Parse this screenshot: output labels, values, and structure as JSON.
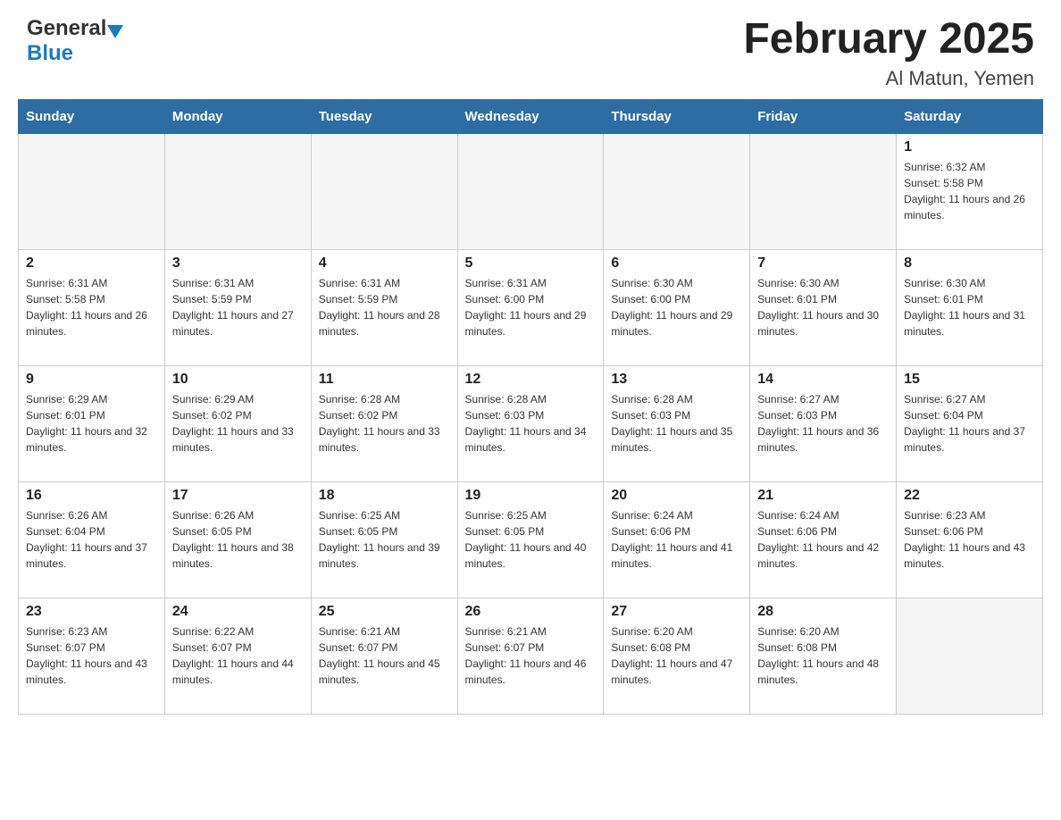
{
  "header": {
    "logo_general": "General",
    "logo_blue": "Blue",
    "title": "February 2025",
    "subtitle": "Al Matun, Yemen"
  },
  "calendar": {
    "days_of_week": [
      "Sunday",
      "Monday",
      "Tuesday",
      "Wednesday",
      "Thursday",
      "Friday",
      "Saturday"
    ],
    "weeks": [
      [
        {
          "day": "",
          "info": ""
        },
        {
          "day": "",
          "info": ""
        },
        {
          "day": "",
          "info": ""
        },
        {
          "day": "",
          "info": ""
        },
        {
          "day": "",
          "info": ""
        },
        {
          "day": "",
          "info": ""
        },
        {
          "day": "1",
          "info": "Sunrise: 6:32 AM\nSunset: 5:58 PM\nDaylight: 11 hours and 26 minutes."
        }
      ],
      [
        {
          "day": "2",
          "info": "Sunrise: 6:31 AM\nSunset: 5:58 PM\nDaylight: 11 hours and 26 minutes."
        },
        {
          "day": "3",
          "info": "Sunrise: 6:31 AM\nSunset: 5:59 PM\nDaylight: 11 hours and 27 minutes."
        },
        {
          "day": "4",
          "info": "Sunrise: 6:31 AM\nSunset: 5:59 PM\nDaylight: 11 hours and 28 minutes."
        },
        {
          "day": "5",
          "info": "Sunrise: 6:31 AM\nSunset: 6:00 PM\nDaylight: 11 hours and 29 minutes."
        },
        {
          "day": "6",
          "info": "Sunrise: 6:30 AM\nSunset: 6:00 PM\nDaylight: 11 hours and 29 minutes."
        },
        {
          "day": "7",
          "info": "Sunrise: 6:30 AM\nSunset: 6:01 PM\nDaylight: 11 hours and 30 minutes."
        },
        {
          "day": "8",
          "info": "Sunrise: 6:30 AM\nSunset: 6:01 PM\nDaylight: 11 hours and 31 minutes."
        }
      ],
      [
        {
          "day": "9",
          "info": "Sunrise: 6:29 AM\nSunset: 6:01 PM\nDaylight: 11 hours and 32 minutes."
        },
        {
          "day": "10",
          "info": "Sunrise: 6:29 AM\nSunset: 6:02 PM\nDaylight: 11 hours and 33 minutes."
        },
        {
          "day": "11",
          "info": "Sunrise: 6:28 AM\nSunset: 6:02 PM\nDaylight: 11 hours and 33 minutes."
        },
        {
          "day": "12",
          "info": "Sunrise: 6:28 AM\nSunset: 6:03 PM\nDaylight: 11 hours and 34 minutes."
        },
        {
          "day": "13",
          "info": "Sunrise: 6:28 AM\nSunset: 6:03 PM\nDaylight: 11 hours and 35 minutes."
        },
        {
          "day": "14",
          "info": "Sunrise: 6:27 AM\nSunset: 6:03 PM\nDaylight: 11 hours and 36 minutes."
        },
        {
          "day": "15",
          "info": "Sunrise: 6:27 AM\nSunset: 6:04 PM\nDaylight: 11 hours and 37 minutes."
        }
      ],
      [
        {
          "day": "16",
          "info": "Sunrise: 6:26 AM\nSunset: 6:04 PM\nDaylight: 11 hours and 37 minutes."
        },
        {
          "day": "17",
          "info": "Sunrise: 6:26 AM\nSunset: 6:05 PM\nDaylight: 11 hours and 38 minutes."
        },
        {
          "day": "18",
          "info": "Sunrise: 6:25 AM\nSunset: 6:05 PM\nDaylight: 11 hours and 39 minutes."
        },
        {
          "day": "19",
          "info": "Sunrise: 6:25 AM\nSunset: 6:05 PM\nDaylight: 11 hours and 40 minutes."
        },
        {
          "day": "20",
          "info": "Sunrise: 6:24 AM\nSunset: 6:06 PM\nDaylight: 11 hours and 41 minutes."
        },
        {
          "day": "21",
          "info": "Sunrise: 6:24 AM\nSunset: 6:06 PM\nDaylight: 11 hours and 42 minutes."
        },
        {
          "day": "22",
          "info": "Sunrise: 6:23 AM\nSunset: 6:06 PM\nDaylight: 11 hours and 43 minutes."
        }
      ],
      [
        {
          "day": "23",
          "info": "Sunrise: 6:23 AM\nSunset: 6:07 PM\nDaylight: 11 hours and 43 minutes."
        },
        {
          "day": "24",
          "info": "Sunrise: 6:22 AM\nSunset: 6:07 PM\nDaylight: 11 hours and 44 minutes."
        },
        {
          "day": "25",
          "info": "Sunrise: 6:21 AM\nSunset: 6:07 PM\nDaylight: 11 hours and 45 minutes."
        },
        {
          "day": "26",
          "info": "Sunrise: 6:21 AM\nSunset: 6:07 PM\nDaylight: 11 hours and 46 minutes."
        },
        {
          "day": "27",
          "info": "Sunrise: 6:20 AM\nSunset: 6:08 PM\nDaylight: 11 hours and 47 minutes."
        },
        {
          "day": "28",
          "info": "Sunrise: 6:20 AM\nSunset: 6:08 PM\nDaylight: 11 hours and 48 minutes."
        },
        {
          "day": "",
          "info": ""
        }
      ]
    ]
  }
}
